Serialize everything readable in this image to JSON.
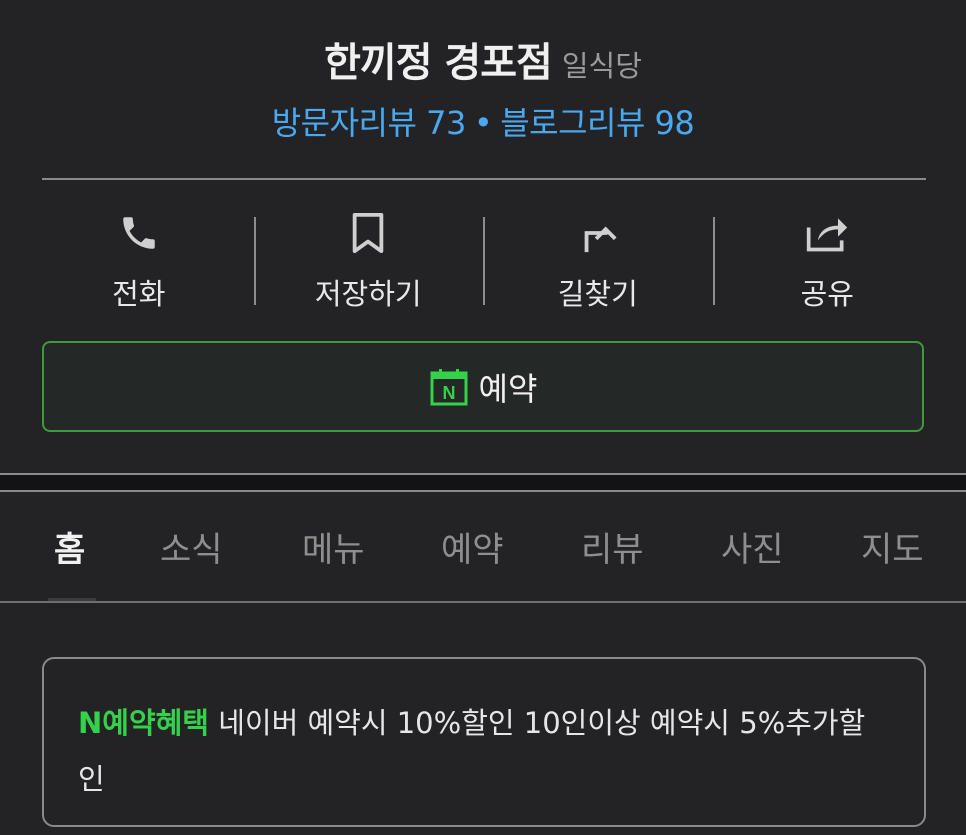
{
  "place": {
    "name": "한끼정 경포점",
    "category": "일식당"
  },
  "reviews": {
    "visitor": "방문자리뷰 73",
    "separator": "•",
    "blog": "블로그리뷰 98"
  },
  "actions": [
    {
      "icon": "phone-icon",
      "label": "전화"
    },
    {
      "icon": "bookmark-icon",
      "label": "저장하기"
    },
    {
      "icon": "directions-icon",
      "label": "길찾기"
    },
    {
      "icon": "share-icon",
      "label": "공유"
    }
  ],
  "reserve": {
    "icon_text": "N",
    "label": "예약",
    "accent": "#3f9a3a"
  },
  "tabs": [
    "홈",
    "소식",
    "메뉴",
    "예약",
    "리뷰",
    "사진",
    "지도"
  ],
  "active_tab": "홈",
  "benefit": {
    "tag": "N예약혜택",
    "text": "네이버 예약시 10%할인 10인이상 예약시 5%추가할인",
    "tag_color": "#34d14a"
  },
  "colors": {
    "background": "#232325",
    "link": "#4aa8f0"
  }
}
